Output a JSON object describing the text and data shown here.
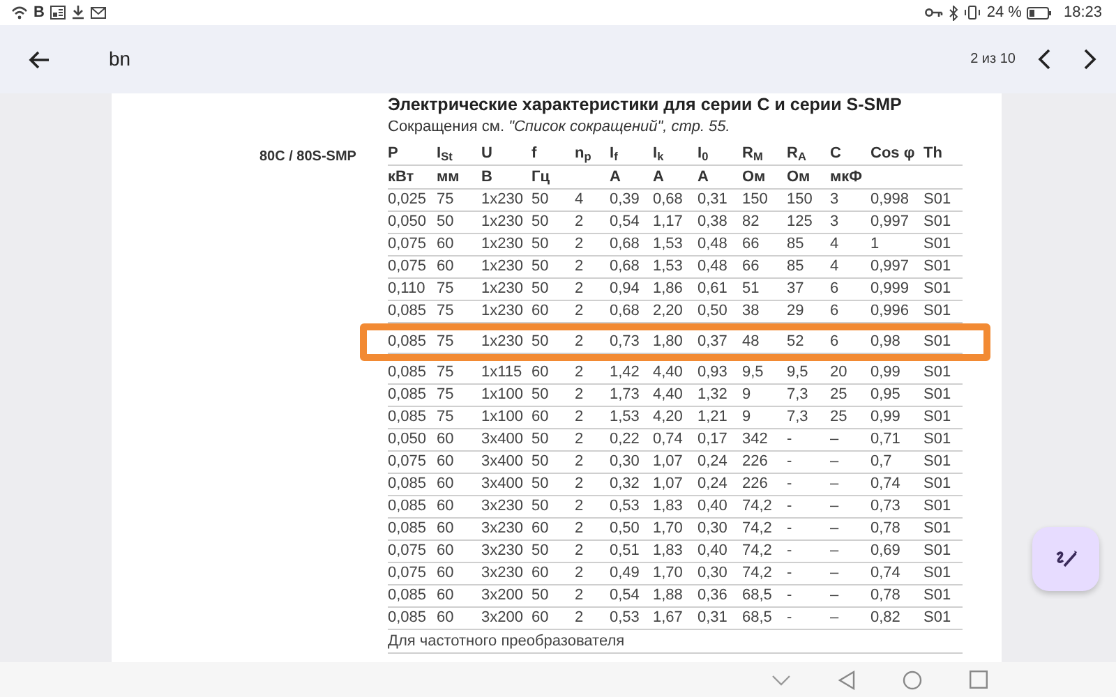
{
  "status_bar": {
    "app_letter": "B",
    "battery_text": "24 %",
    "time": "18:23"
  },
  "toolbar": {
    "title": "bn",
    "page_indicator": "2 из 10"
  },
  "document": {
    "heading": "Электрические характеристики для серии C и серии S-SMP",
    "subtitle": "Сокращения см. *\"Список сокращений\", стр. 55.*",
    "model_label": "80C / 80S-SMP",
    "table": {
      "columns": [
        {
          "symbol": "P",
          "unit": "кВт"
        },
        {
          "symbol": "I$_{St}$",
          "unit": "мм"
        },
        {
          "symbol": "U",
          "unit": "В"
        },
        {
          "symbol": "f",
          "unit": "Гц"
        },
        {
          "symbol": "n$_{p}$"
        },
        {
          "symbol": "I$_{f}$",
          "unit": "А"
        },
        {
          "symbol": "I$_{k}$",
          "unit": "А"
        },
        {
          "symbol": "I$_{0}$",
          "unit": "А"
        },
        {
          "symbol": "R$_{M}$",
          "unit": "Ом"
        },
        {
          "symbol": "R$_{A}$",
          "unit": "Ом"
        },
        {
          "symbol": "C",
          "unit": "мкФ"
        },
        {
          "symbol": "Cos φ"
        },
        {
          "symbol": "Th"
        }
      ],
      "rows": [
        {
          "cells": [
            "0,025",
            "75",
            "1x230",
            "50",
            "4",
            "0,39",
            "0,68",
            "0,31",
            "150",
            "150",
            "3",
            "0,998",
            "S01"
          ],
          "highlighted": false
        },
        {
          "cells": [
            "0,050",
            "50",
            "1x230",
            "50",
            "2",
            "0,54",
            "1,17",
            "0,38",
            "82",
            "125",
            "3",
            "0,997",
            "S01"
          ],
          "highlighted": false
        },
        {
          "cells": [
            "0,075",
            "60",
            "1x230",
            "50",
            "2",
            "0,68",
            "1,53",
            "0,48",
            "66",
            "85",
            "4",
            "1",
            "S01"
          ],
          "highlighted": false
        },
        {
          "cells": [
            "0,075",
            "60",
            "1x230",
            "50",
            "2",
            "0,68",
            "1,53",
            "0,48",
            "66",
            "85",
            "4",
            "0,997",
            "S01"
          ],
          "highlighted": false
        },
        {
          "cells": [
            "0,110",
            "75",
            "1x230",
            "50",
            "2",
            "0,94",
            "1,86",
            "0,61",
            "51",
            "37",
            "6",
            "0,999",
            "S01"
          ],
          "highlighted": false
        },
        {
          "cells": [
            "0,085",
            "75",
            "1x230",
            "60",
            "2",
            "0,68",
            "2,20",
            "0,50",
            "38",
            "29",
            "6",
            "0,996",
            "S01"
          ],
          "highlighted": false
        },
        {
          "cells": [
            "0,085",
            "75",
            "1x230",
            "50",
            "2",
            "0,73",
            "1,80",
            "0,37",
            "48",
            "52",
            "6",
            "0,98",
            "S01"
          ],
          "highlighted": true
        },
        {
          "cells": [
            "0,085",
            "75",
            "1x115",
            "60",
            "2",
            "1,42",
            "4,40",
            "0,93",
            "9,5",
            "9,5",
            "20",
            "0,99",
            "S01"
          ],
          "highlighted": false
        },
        {
          "cells": [
            "0,085",
            "75",
            "1x100",
            "50",
            "2",
            "1,73",
            "4,40",
            "1,32",
            "9",
            "7,3",
            "25",
            "0,95",
            "S01"
          ],
          "highlighted": false
        },
        {
          "cells": [
            "0,085",
            "75",
            "1x100",
            "60",
            "2",
            "1,53",
            "4,20",
            "1,21",
            "9",
            "7,3",
            "25",
            "0,99",
            "S01"
          ],
          "highlighted": false
        },
        {
          "cells": [
            "0,050",
            "60",
            "3x400",
            "50",
            "2",
            "0,22",
            "0,74",
            "0,17",
            "342",
            "-",
            "–",
            "0,71",
            "S01"
          ],
          "highlighted": false
        },
        {
          "cells": [
            "0,075",
            "60",
            "3x400",
            "50",
            "2",
            "0,30",
            "1,07",
            "0,24",
            "226",
            "-",
            "–",
            "0,7",
            "S01"
          ],
          "highlighted": false
        },
        {
          "cells": [
            "0,085",
            "60",
            "3x400",
            "50",
            "2",
            "0,32",
            "1,07",
            "0,24",
            "226",
            "-",
            "–",
            "0,74",
            "S01"
          ],
          "highlighted": false
        },
        {
          "cells": [
            "0,085",
            "60",
            "3x230",
            "50",
            "2",
            "0,53",
            "1,83",
            "0,40",
            "74,2",
            "-",
            "–",
            "0,73",
            "S01"
          ],
          "highlighted": false
        },
        {
          "cells": [
            "0,085",
            "60",
            "3x230",
            "60",
            "2",
            "0,50",
            "1,70",
            "0,30",
            "74,2",
            "-",
            "–",
            "0,78",
            "S01"
          ],
          "highlighted": false
        },
        {
          "cells": [
            "0,075",
            "60",
            "3x230",
            "50",
            "2",
            "0,51",
            "1,83",
            "0,40",
            "74,2",
            "-",
            "–",
            "0,69",
            "S01"
          ],
          "highlighted": false
        },
        {
          "cells": [
            "0,075",
            "60",
            "3x230",
            "60",
            "2",
            "0,49",
            "1,70",
            "0,30",
            "74,2",
            "-",
            "–",
            "0,74",
            "S01"
          ],
          "highlighted": false
        },
        {
          "cells": [
            "0,085",
            "60",
            "3x200",
            "50",
            "2",
            "0,54",
            "1,88",
            "0,36",
            "68,5",
            "-",
            "–",
            "0,78",
            "S01"
          ],
          "highlighted": false
        },
        {
          "cells": [
            "0,085",
            "60",
            "3x200",
            "60",
            "2",
            "0,53",
            "1,67",
            "0,31",
            "68,5",
            "-",
            "–",
            "0,82",
            "S01"
          ],
          "highlighted": false
        }
      ]
    },
    "footer_note": "Для частотного преобразователя"
  }
}
